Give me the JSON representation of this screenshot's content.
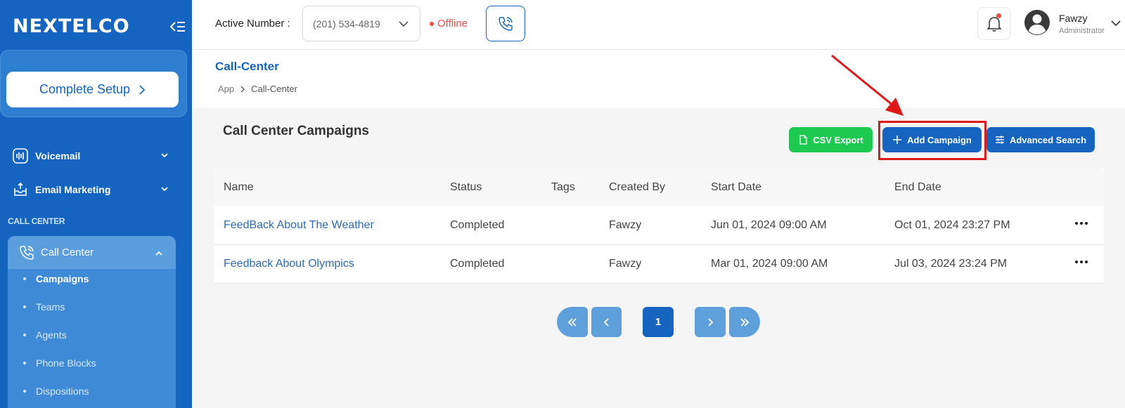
{
  "brand": {
    "logo_text": "NEXTELCO"
  },
  "sidebar": {
    "setup_button": "Complete Setup",
    "items": [
      {
        "label": "Voicemail",
        "icon": "voicemail-icon"
      },
      {
        "label": "Email Marketing",
        "icon": "email-inbox-icon"
      }
    ],
    "section_label": "CALL CENTER",
    "call_center": {
      "label": "Call Center",
      "icon": "phone-call-icon",
      "sub_items": [
        "Campaigns",
        "Teams",
        "Agents",
        "Phone Blocks",
        "Dispositions"
      ],
      "active": "Campaigns"
    }
  },
  "topbar": {
    "active_number_label": "Active Number :",
    "active_number_value": "(201) 534-4819",
    "status": "Offline",
    "user": {
      "name": "Fawzy",
      "role": "Administrator"
    }
  },
  "header": {
    "title": "Call-Center",
    "breadcrumb": [
      "App",
      "Call-Center"
    ]
  },
  "main": {
    "section_title": "Call Center Campaigns",
    "buttons": {
      "csv_export": "CSV Export",
      "add_campaign": "Add Campaign",
      "advanced_search": "Advanced Search"
    },
    "table": {
      "columns": [
        "Name",
        "Status",
        "Tags",
        "Created By",
        "Start Date",
        "End Date"
      ],
      "rows": [
        {
          "name": "FeedBack About The Weather",
          "status": "Completed",
          "tags": "",
          "created_by": "Fawzy",
          "start_date": "Jun 01, 2024 09:00 AM",
          "end_date": "Oct 01, 2024 23:27 PM"
        },
        {
          "name": "Feedback About Olympics",
          "status": "Completed",
          "tags": "",
          "created_by": "Fawzy",
          "start_date": "Mar 01, 2024 09:00 AM",
          "end_date": "Jul 03, 2024 23:24 PM"
        }
      ]
    },
    "pagination": {
      "current_page": "1"
    }
  },
  "colors": {
    "brand_blue": "#1565c0",
    "csv_green": "#1ec94f",
    "offline_red": "#ef4b4b",
    "highlight_red": "#e01818"
  }
}
